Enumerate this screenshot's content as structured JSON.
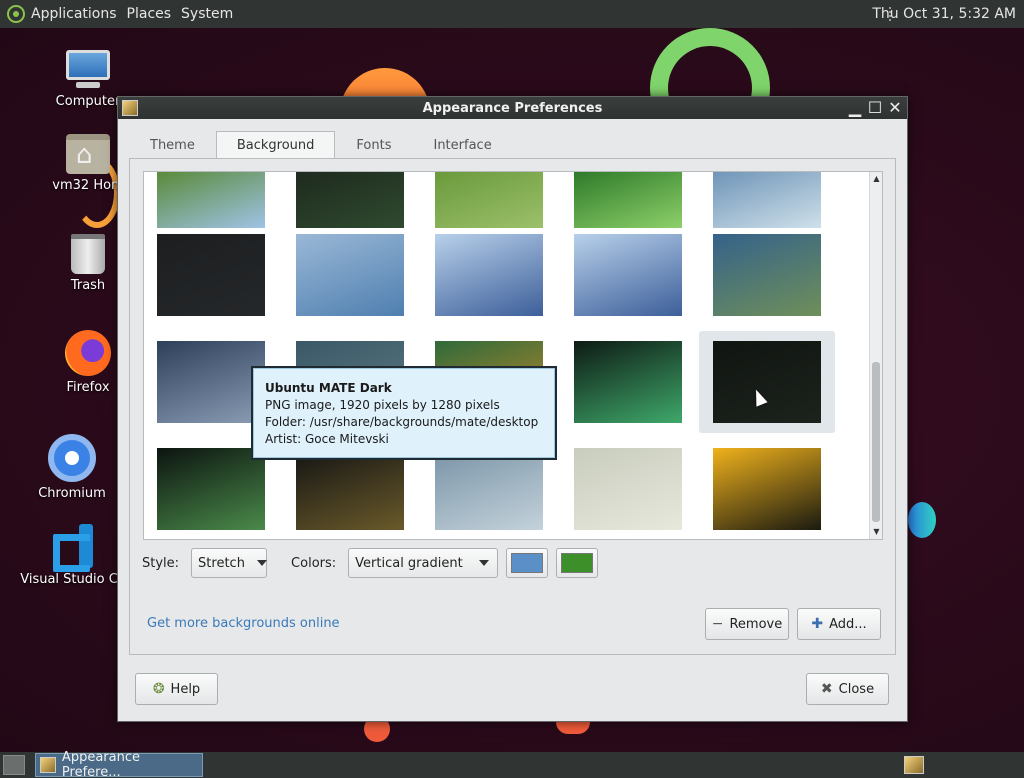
{
  "top_panel": {
    "menus": [
      "Applications",
      "Places",
      "System"
    ],
    "clock": "Thu Oct 31,  5:32 AM"
  },
  "desktop_icons": [
    {
      "label": "Computer",
      "icon": "computer-icon"
    },
    {
      "label": "vm32 Hom",
      "icon": "home-folder-icon"
    },
    {
      "label": "Trash",
      "icon": "trash-icon"
    },
    {
      "label": "Firefox",
      "icon": "firefox-icon"
    },
    {
      "label": "Chromium",
      "icon": "chromium-icon"
    },
    {
      "label": "Visual Studio Co",
      "icon": "vscode-icon"
    }
  ],
  "window": {
    "title": "Appearance Preferences",
    "tabs": [
      {
        "label": "Theme",
        "active": false
      },
      {
        "label": "Background",
        "active": true
      },
      {
        "label": "Fonts",
        "active": false
      },
      {
        "label": "Interface",
        "active": false
      }
    ],
    "thumbnails": [
      {
        "name": "green-leaves-blue-flowers",
        "colors": [
          "#5a8a3a",
          "#9fc3e6"
        ]
      },
      {
        "name": "mate-logo-dark",
        "colors": [
          "#1e2a1e",
          "#2f4a2f"
        ]
      },
      {
        "name": "mate-logo-green",
        "colors": [
          "#6a9a3c",
          "#9cc06a"
        ]
      },
      {
        "name": "green-leaf-drops",
        "colors": [
          "#2f7a2a",
          "#8dd06a"
        ]
      },
      {
        "name": "blue-waves-light",
        "colors": [
          "#6f95b8",
          "#cfe0ea"
        ]
      },
      {
        "name": "archlinux-dark",
        "colors": [
          "#1c1e20",
          "#25282a"
        ]
      },
      {
        "name": "abstract-blue-paint",
        "colors": [
          "#9ab8d6",
          "#4f7fb0"
        ]
      },
      {
        "name": "blue-crystal-city-1",
        "colors": [
          "#b8d0ea",
          "#3d5f9a"
        ]
      },
      {
        "name": "blue-crystal-city-2",
        "colors": [
          "#b8d0ea",
          "#3d5f9a"
        ]
      },
      {
        "name": "green-sky-clouds",
        "colors": [
          "#34628a",
          "#6f8f5a"
        ]
      },
      {
        "name": "stormy-lake",
        "colors": [
          "#2e3f5a",
          "#8b9db5"
        ]
      },
      {
        "name": "teal-blur",
        "colors": [
          "#3a5866",
          "#5f7b86"
        ]
      },
      {
        "name": "green-orange-bokeh",
        "colors": [
          "#2f6a3a",
          "#c58a2a"
        ]
      },
      {
        "name": "aurora-green",
        "colors": [
          "#0d1a14",
          "#3fa86a"
        ]
      },
      {
        "name": "ubuntu-mate-dark",
        "colors": [
          "#101511",
          "#1c221c"
        ]
      },
      {
        "name": "aurora-dark-green",
        "colors": [
          "#0c1410",
          "#4a8a4a"
        ]
      },
      {
        "name": "dark-rainbow-blur",
        "colors": [
          "#131313",
          "#6a5a2a"
        ]
      },
      {
        "name": "blue-gray-waves",
        "colors": [
          "#7893a6",
          "#c4d2db"
        ]
      },
      {
        "name": "pale-sand-road",
        "colors": [
          "#c9cdbd",
          "#e6e8dc"
        ]
      },
      {
        "name": "yellow-flower",
        "colors": [
          "#f0b21c",
          "#1a1a10"
        ]
      }
    ],
    "tooltip": {
      "title": "Ubuntu MATE Dark",
      "line1": "PNG image, 1920 pixels by 1280 pixels",
      "line2": "Folder: /usr/share/backgrounds/mate/desktop",
      "line3": "Artist: Goce Mitevski"
    },
    "style_label": "Style:",
    "style_value": "Stretch",
    "colors_label": "Colors:",
    "colors_value": "Vertical gradient",
    "primary_color": "#5b8fc7",
    "secondary_color": "#3d8f2a",
    "get_more_link": "Get more backgrounds online",
    "remove_label": "Remove",
    "add_label": "Add...",
    "help_label": "Help",
    "close_label": "Close"
  },
  "taskbar": {
    "task_label": "Appearance Prefere..."
  }
}
